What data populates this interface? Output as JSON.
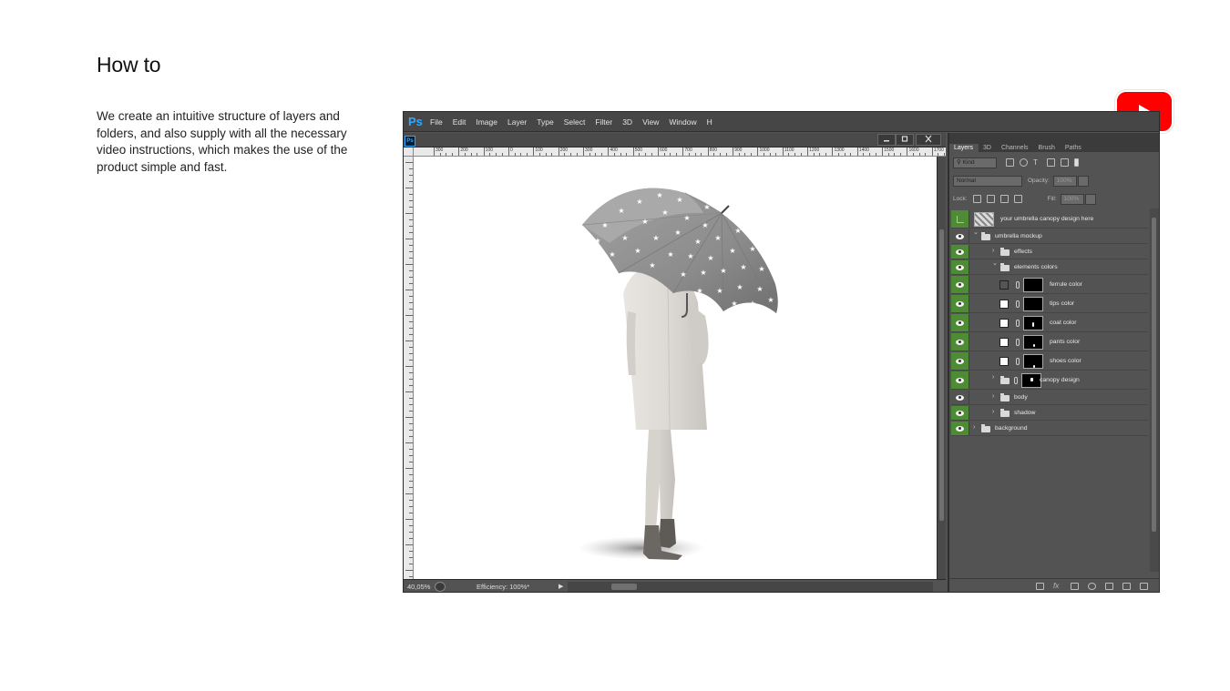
{
  "page": {
    "title": "How to",
    "description": "We create an intuitive structure of layers and folders, and also supply with all the necessary video instructions, which makes the use of the product simple and fast."
  },
  "youtube": {
    "icon": "youtube-play-icon",
    "color": "#ff0000"
  },
  "photoshop": {
    "logo": "Ps",
    "menu": [
      "File",
      "Edit",
      "Image",
      "Layer",
      "Type",
      "Select",
      "Filter",
      "3D",
      "View",
      "Window",
      "H"
    ],
    "doc_logo": "Ps",
    "ruler_labels": [
      "300",
      "200",
      "100",
      "0",
      "100",
      "200",
      "300",
      "400",
      "500",
      "600",
      "700",
      "800",
      "900",
      "1000",
      "1100",
      "1200",
      "1300",
      "1400",
      "1500",
      "1600",
      "1700",
      "1800"
    ],
    "status": {
      "zoom": "40,05%",
      "efficiency": "Efficiency: 100%*"
    },
    "colors": {
      "accent": "#31a8ff",
      "eye_on": "#4e8b35",
      "panel_bg": "#535353",
      "menubar_bg": "#464646"
    }
  },
  "layers_panel": {
    "tabs": [
      "Layers",
      "3D",
      "Channels",
      "Brush",
      "Paths"
    ],
    "active_tab": "Layers",
    "filter_kind": "Kind",
    "blend_mode": "Normal",
    "opacity_label": "Opacity:",
    "opacity_value": "100%",
    "lock_label": "Lock:",
    "fill_label": "Fill:",
    "fill_value": "100%",
    "layers": [
      {
        "name": "your umbrella canopy design here",
        "visible": false,
        "type": "smart-object"
      },
      {
        "name": "umbrella mockup",
        "visible": true,
        "type": "group",
        "expanded": true
      },
      {
        "name": "effects",
        "visible": true,
        "type": "group",
        "expanded": false
      },
      {
        "name": "elements colors",
        "visible": true,
        "type": "group",
        "expanded": true
      },
      {
        "name": "ferrule color",
        "visible": true,
        "type": "fill",
        "swatch": "#555555"
      },
      {
        "name": "tips color",
        "visible": true,
        "type": "fill",
        "swatch": "#ffffff"
      },
      {
        "name": "coat color",
        "visible": true,
        "type": "fill",
        "swatch": "#ffffff"
      },
      {
        "name": "pants color",
        "visible": true,
        "type": "fill",
        "swatch": "#ffffff"
      },
      {
        "name": "shoes color",
        "visible": true,
        "type": "fill",
        "swatch": "#ffffff"
      },
      {
        "name": "canopy design",
        "visible": true,
        "type": "group-masked"
      },
      {
        "name": "body",
        "visible": false,
        "type": "group"
      },
      {
        "name": "shadow",
        "visible": true,
        "type": "group"
      },
      {
        "name": "background",
        "visible": true,
        "type": "group"
      }
    ]
  }
}
